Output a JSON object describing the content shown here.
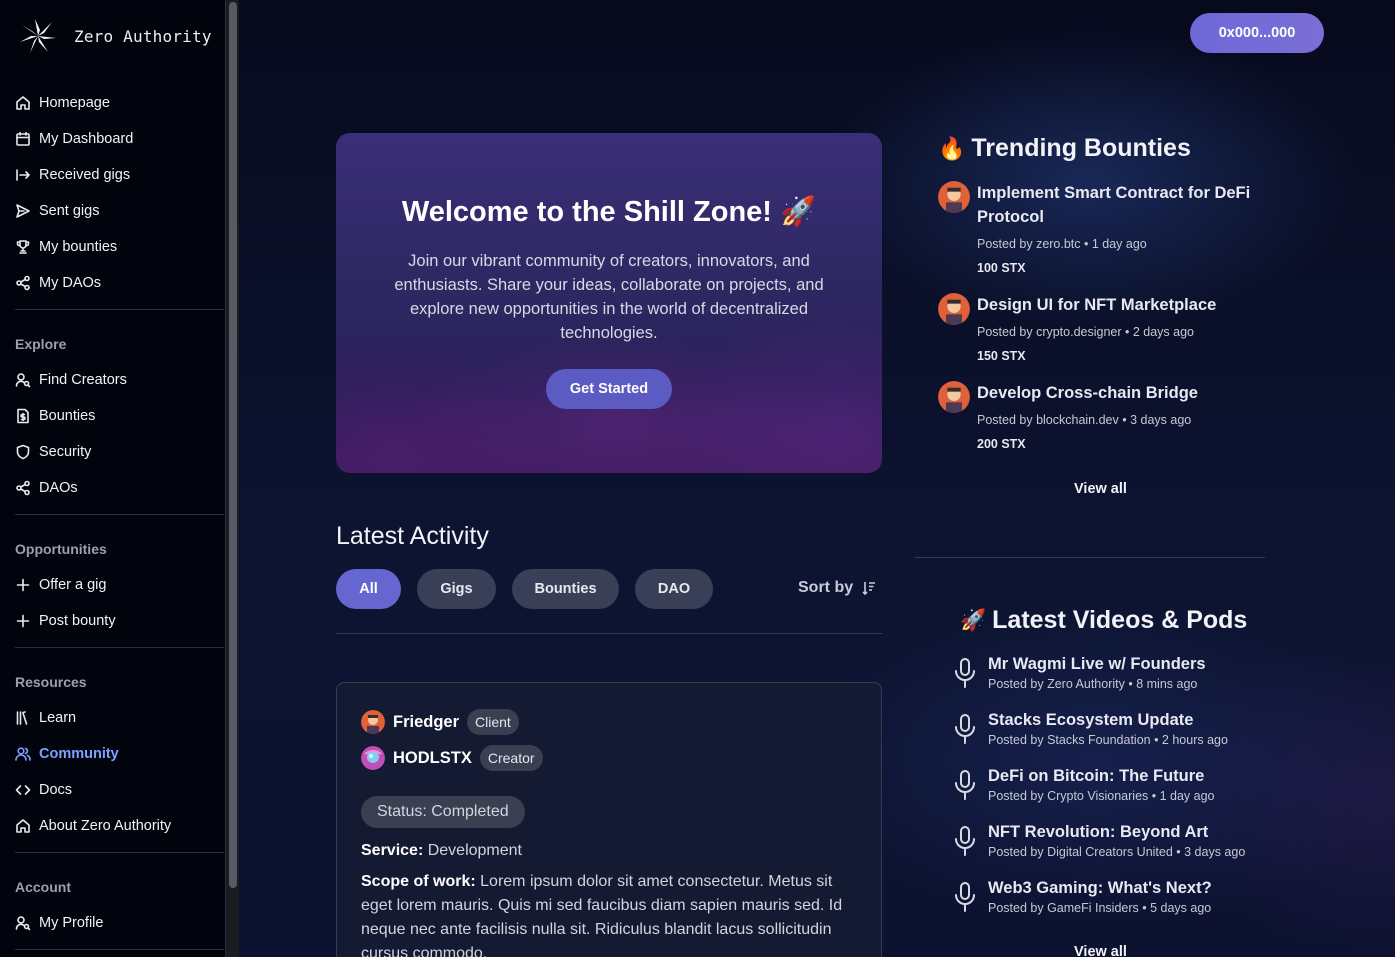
{
  "app": {
    "name": "Zero Authority"
  },
  "sidebar": {
    "main_items": [
      {
        "label": "Homepage",
        "icon": "home-icon"
      },
      {
        "label": "My Dashboard",
        "icon": "calendar-icon"
      },
      {
        "label": "Received gigs",
        "icon": "arrow-in-icon"
      },
      {
        "label": "Sent gigs",
        "icon": "send-icon"
      },
      {
        "label": "My bounties",
        "icon": "trophy-icon"
      },
      {
        "label": "My DAOs",
        "icon": "share-nodes-icon"
      }
    ],
    "explore": {
      "title": "Explore",
      "items": [
        {
          "label": "Find Creators",
          "icon": "user-search-icon"
        },
        {
          "label": "Bounties",
          "icon": "dollar-file-icon"
        },
        {
          "label": "Security",
          "icon": "shield-icon"
        },
        {
          "label": "DAOs",
          "icon": "share-nodes-icon"
        }
      ]
    },
    "opportunities": {
      "title": "Opportunities",
      "items": [
        {
          "label": "Offer a gig",
          "icon": "plus-icon"
        },
        {
          "label": "Post bounty",
          "icon": "plus-icon"
        }
      ]
    },
    "resources": {
      "title": "Resources",
      "items": [
        {
          "label": "Learn",
          "icon": "library-icon"
        },
        {
          "label": "Community",
          "icon": "users-icon",
          "active": true
        },
        {
          "label": "Docs",
          "icon": "code-icon"
        },
        {
          "label": "About Zero Authority",
          "icon": "home-icon"
        }
      ]
    },
    "account": {
      "title": "Account",
      "items": [
        {
          "label": "My Profile",
          "icon": "user-search-icon"
        }
      ]
    }
  },
  "header": {
    "wallet_label": "0x000...000"
  },
  "hero": {
    "title": "Welcome to the Shill Zone! 🚀",
    "text": "Join our vibrant community of creators, innovators, and enthusiasts. Share your ideas, collaborate on projects, and explore new opportunities in the world of decentralized technologies.",
    "cta": "Get Started"
  },
  "activity": {
    "title": "Latest Activity",
    "filters": [
      "All",
      "Gigs",
      "Bounties",
      "DAO"
    ],
    "active_filter": "All",
    "sort_label": "Sort by",
    "card": {
      "client_name": "Friedger",
      "client_tag": "Client",
      "creator_name": "HODLSTX",
      "creator_tag": "Creator",
      "status": "Status: Completed",
      "service_label": "Service:",
      "service_value": "Development",
      "scope_label": "Scope of work:",
      "scope_value": "Lorem ipsum dolor sit amet consectetur. Metus sit eget lorem mauris. Quis mi sed faucibus diam sapien mauris sed. Id neque nec ante facilisis nulla sit. Ridiculus blandit lacus sollicitudin cursus commodo."
    }
  },
  "trending": {
    "title": "Trending Bounties",
    "icon": "fire-icon",
    "items": [
      {
        "title": "Implement Smart Contract for DeFi Protocol",
        "meta": "Posted by zero.btc • 1 day ago",
        "amount": "100 STX"
      },
      {
        "title": "Design UI for NFT Marketplace",
        "meta": "Posted by crypto.designer • 2 days ago",
        "amount": "150 STX"
      },
      {
        "title": "Develop Cross-chain Bridge",
        "meta": "Posted by blockchain.dev • 3 days ago",
        "amount": "200 STX"
      }
    ],
    "view_all": "View all"
  },
  "videos": {
    "title": "Latest Videos & Pods",
    "icon": "rocket-icon",
    "items": [
      {
        "title": "Mr Wagmi Live w/ Founders",
        "meta": "Posted by Zero Authority • 8 mins ago"
      },
      {
        "title": "Stacks Ecosystem Update",
        "meta": "Posted by Stacks Foundation • 2 hours ago"
      },
      {
        "title": "DeFi on Bitcoin: The Future",
        "meta": "Posted by Crypto Visionaries • 1 day ago"
      },
      {
        "title": "NFT Revolution: Beyond Art",
        "meta": "Posted by Digital Creators United • 3 days ago"
      },
      {
        "title": "Web3 Gaming: What's Next?",
        "meta": "Posted by GameFi Insiders • 5 days ago"
      }
    ],
    "view_all": "View all"
  },
  "colors": {
    "accent": "#6566cf",
    "active_nav": "#7ea0ff",
    "sidebar_bg": "#02040d"
  }
}
